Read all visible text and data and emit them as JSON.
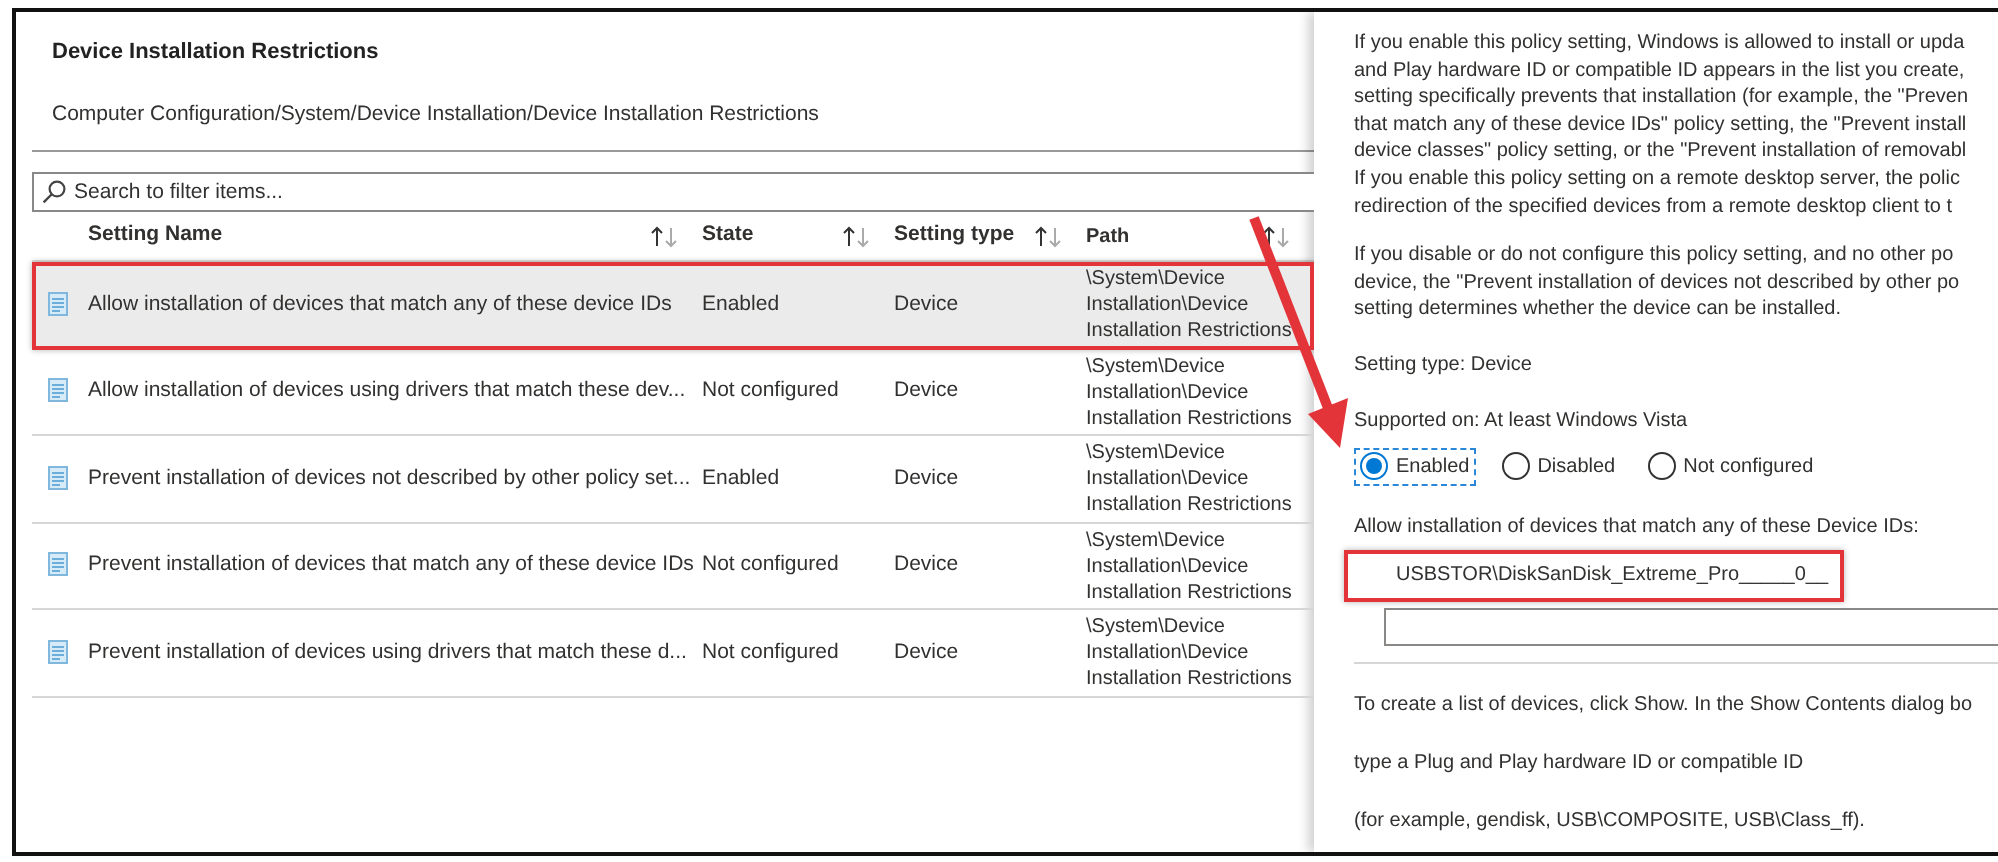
{
  "header": {
    "title": "Device Installation Restrictions",
    "breadcrumb": "Computer Configuration/System/Device Installation/Device Installation Restrictions"
  },
  "search": {
    "placeholder": "Search to filter items..."
  },
  "table": {
    "columns": [
      "Setting Name",
      "State",
      "Setting type",
      "Path"
    ],
    "rows": [
      {
        "name": "Allow installation of devices that match any of these device IDs",
        "state": "Enabled",
        "type": "Device",
        "path": [
          "\\System\\Device",
          "Installation\\Device",
          "Installation Restrictions"
        ],
        "selected": true,
        "highlighted": true
      },
      {
        "name": "Allow installation of devices using drivers that match these dev...",
        "state": "Not configured",
        "type": "Device",
        "path": [
          "\\System\\Device",
          "Installation\\Device",
          "Installation Restrictions"
        ],
        "selected": false,
        "highlighted": false
      },
      {
        "name": "Prevent installation of devices not described by other policy set...",
        "state": "Enabled",
        "type": "Device",
        "path": [
          "\\System\\Device",
          "Installation\\Device",
          "Installation Restrictions"
        ],
        "selected": false,
        "highlighted": false
      },
      {
        "name": "Prevent installation of devices that match any of these device IDs",
        "state": "Not configured",
        "type": "Device",
        "path": [
          "\\System\\Device",
          "Installation\\Device",
          "Installation Restrictions"
        ],
        "selected": false,
        "highlighted": false
      },
      {
        "name": "Prevent installation of devices using drivers that match these d...",
        "state": "Not configured",
        "type": "Device",
        "path": [
          "\\System\\Device",
          "Installation\\Device",
          "Installation Restrictions"
        ],
        "selected": false,
        "highlighted": false
      }
    ]
  },
  "details": {
    "paragraphs": [
      [
        "If you enable this policy setting, Windows is allowed to install or upda",
        "and Play hardware ID or compatible ID appears in the list you create,",
        "setting specifically prevents that installation (for example, the \"Preven",
        "that match any of these device IDs\" policy setting, the \"Prevent install",
        "device classes\" policy setting, or the \"Prevent installation of removabl",
        "If you enable this policy setting on a remote desktop server, the polic",
        "redirection of the specified devices from a remote desktop client to t"
      ],
      [
        "If you disable or do not configure this policy setting, and no other po",
        "device, the \"Prevent installation of devices not described by other po",
        "setting determines whether the device can be installed."
      ]
    ],
    "setting_type": "Setting type: Device",
    "supported_on": "Supported on: At least Windows Vista",
    "options": [
      {
        "label": "Enabled",
        "selected": true
      },
      {
        "label": "Disabled",
        "selected": false
      },
      {
        "label": "Not configured",
        "selected": false
      }
    ],
    "list_label": "Allow installation of devices that match any of these Device IDs:",
    "list_values": [
      {
        "value": "USBSTOR\\DiskSanDisk_Extreme_Pro_____0__",
        "highlighted": true
      },
      {
        "highlighted": false
      }
    ],
    "help": [
      "To create a list of devices, click Show. In the Show Contents dialog bo",
      "type a Plug and Play hardware ID or compatible ID",
      "(for example, gendisk, USB\\COMPOSITE, USB\\Class_ff)."
    ]
  }
}
